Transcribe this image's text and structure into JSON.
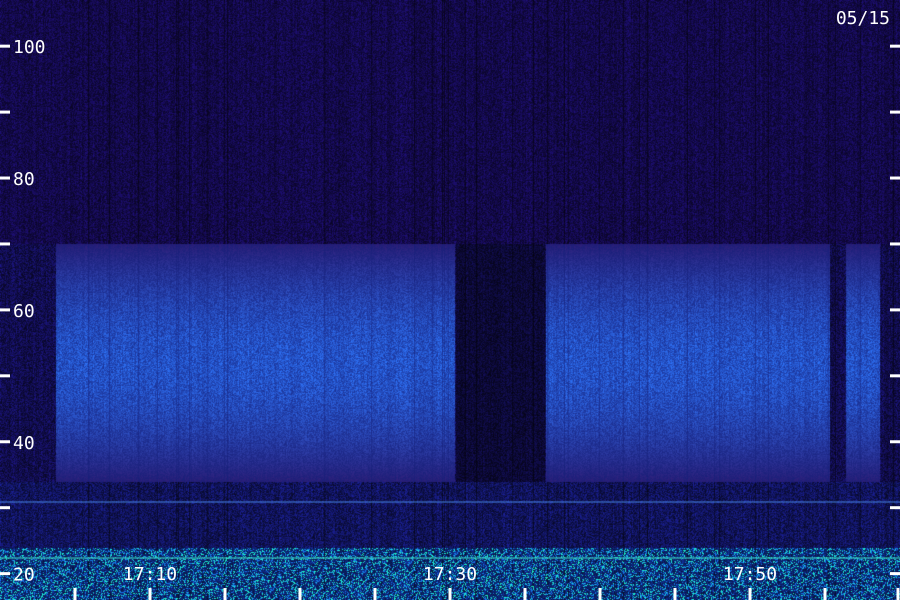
{
  "chart_data": {
    "type": "heatmap",
    "date_label": "05/15",
    "y_ticks": [
      {
        "value": 20,
        "label": "20"
      },
      {
        "value": 30,
        "label": ""
      },
      {
        "value": 40,
        "label": "40"
      },
      {
        "value": 50,
        "label": ""
      },
      {
        "value": 60,
        "label": "60"
      },
      {
        "value": 70,
        "label": ""
      },
      {
        "value": 80,
        "label": "80"
      },
      {
        "value": 90,
        "label": ""
      },
      {
        "value": 100,
        "label": "100"
      }
    ],
    "x_ticks": [
      {
        "minute": 5,
        "label": ""
      },
      {
        "minute": 10,
        "label": "17:10"
      },
      {
        "minute": 15,
        "label": ""
      },
      {
        "minute": 20,
        "label": ""
      },
      {
        "minute": 25,
        "label": ""
      },
      {
        "minute": 30,
        "label": "17:30"
      },
      {
        "minute": 35,
        "label": ""
      },
      {
        "minute": 40,
        "label": ""
      },
      {
        "minute": 45,
        "label": ""
      },
      {
        "minute": 50,
        "label": "17:50"
      },
      {
        "minute": 55,
        "label": ""
      },
      {
        "minute": 60,
        "label": ""
      }
    ],
    "ylim": [
      16,
      107
    ],
    "xlim_minutes": [
      0,
      60
    ],
    "colors": {
      "background": "#1a0f5a",
      "mid": "#2a4ae0",
      "high": "#28e0b8",
      "label": "#ffffff"
    }
  }
}
